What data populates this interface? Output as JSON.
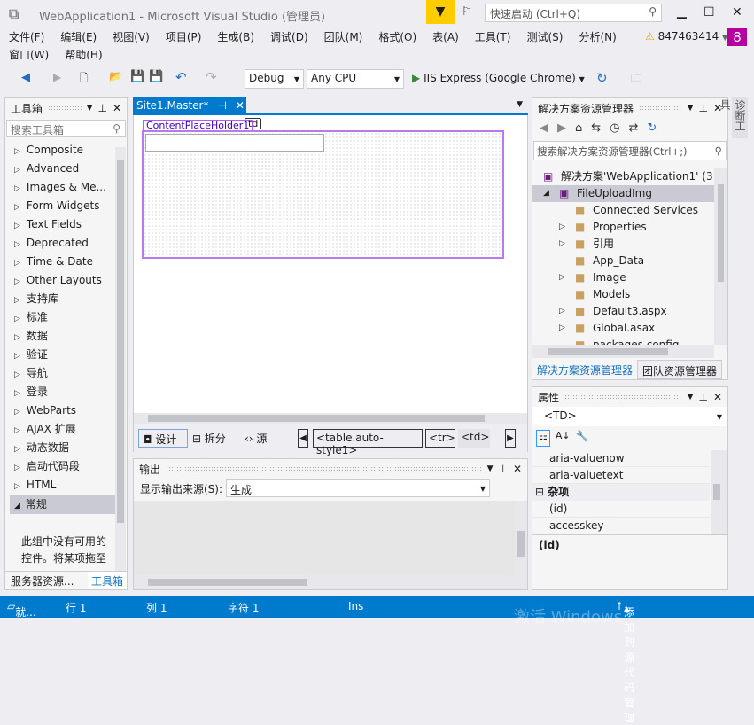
{
  "title": {
    "text": "WebApplication1 - Microsoft Visual Studio (管理员)",
    "quick_launch": "快速启动 (Ctrl+Q)",
    "min": "▁",
    "max": "☐",
    "close": "✕"
  },
  "menu": [
    "文件(F)",
    "编辑(E)",
    "视图(V)",
    "项目(P)",
    "生成(B)",
    "调试(D)",
    "团队(M)",
    "格式(O)",
    "表(A)",
    "工具(T)",
    "测试(S)",
    "分析(N)"
  ],
  "menu2": [
    "窗口(W)",
    "帮助(H)"
  ],
  "account": {
    "name": "847463414",
    "badge": "8"
  },
  "toolbar": {
    "config": "Debug",
    "platform": "Any CPU",
    "run": "IIS Express (Google Chrome)"
  },
  "toolbox": {
    "title": "工具箱",
    "search_placeholder": "搜索工具箱",
    "items": [
      "Composite",
      "Advanced",
      "Images & Me...",
      "Form Widgets",
      "Text Fields",
      "Deprecated",
      "Time & Date",
      "Other Layouts",
      "支持库",
      "标准",
      "数据",
      "验证",
      "导航",
      "登录",
      "WebParts",
      "AJAX 扩展",
      "动态数据",
      "启动代码段",
      "HTML"
    ],
    "expanded": "常规",
    "empty_text": "此组中没有可用的控件。将某项拖至此文本可将",
    "tabs": [
      "服务器资源...",
      "工具箱"
    ]
  },
  "editor": {
    "tab": "Site1.Master*",
    "placeholder_tag": "ContentPlaceHolder1",
    "td_tag": "td",
    "views": [
      "设计",
      "拆分",
      "源"
    ],
    "breadcrumbs": [
      "<table.auto-style1>",
      "<tr>",
      "<td>"
    ]
  },
  "output": {
    "title": "输出",
    "source_label": "显示输出来源(S):",
    "source_value": "生成"
  },
  "solution": {
    "title": "解决方案资源管理器",
    "search_placeholder": "搜索解决方案资源管理器(Ctrl+;)",
    "items": [
      {
        "label": "解决方案'WebApplication1' (3",
        "level": 0,
        "arrow": ""
      },
      {
        "label": "FileUploadImg",
        "level": 1,
        "arrow": "◢"
      },
      {
        "label": "Connected Services",
        "level": 2,
        "arrow": ""
      },
      {
        "label": "Properties",
        "level": 2,
        "arrow": "▷"
      },
      {
        "label": "引用",
        "level": 2,
        "arrow": "▷"
      },
      {
        "label": "App_Data",
        "level": 2,
        "arrow": ""
      },
      {
        "label": "Image",
        "level": 2,
        "arrow": "▷"
      },
      {
        "label": "Models",
        "level": 2,
        "arrow": ""
      },
      {
        "label": "Default3.aspx",
        "level": 2,
        "arrow": "▷"
      },
      {
        "label": "Global.asax",
        "level": 2,
        "arrow": "▷"
      },
      {
        "label": "packages.config",
        "level": 2,
        "arrow": ""
      }
    ],
    "tabs": [
      "解决方案资源管理器",
      "团队资源管理器"
    ]
  },
  "properties": {
    "title": "属性",
    "object": "<TD>",
    "rows": [
      "aria-valuenow",
      "aria-valuetext"
    ],
    "category": "杂项",
    "rows2": [
      "(id)",
      "accesskey"
    ],
    "description": "(id)"
  },
  "side_tab": "诊断工具",
  "status": {
    "ready": "就...",
    "line": "行 1",
    "col": "列 1",
    "char": "字符 1",
    "ins": "Ins",
    "source_control": "添加到源代码管理",
    "watermark": "激活 Windows"
  }
}
